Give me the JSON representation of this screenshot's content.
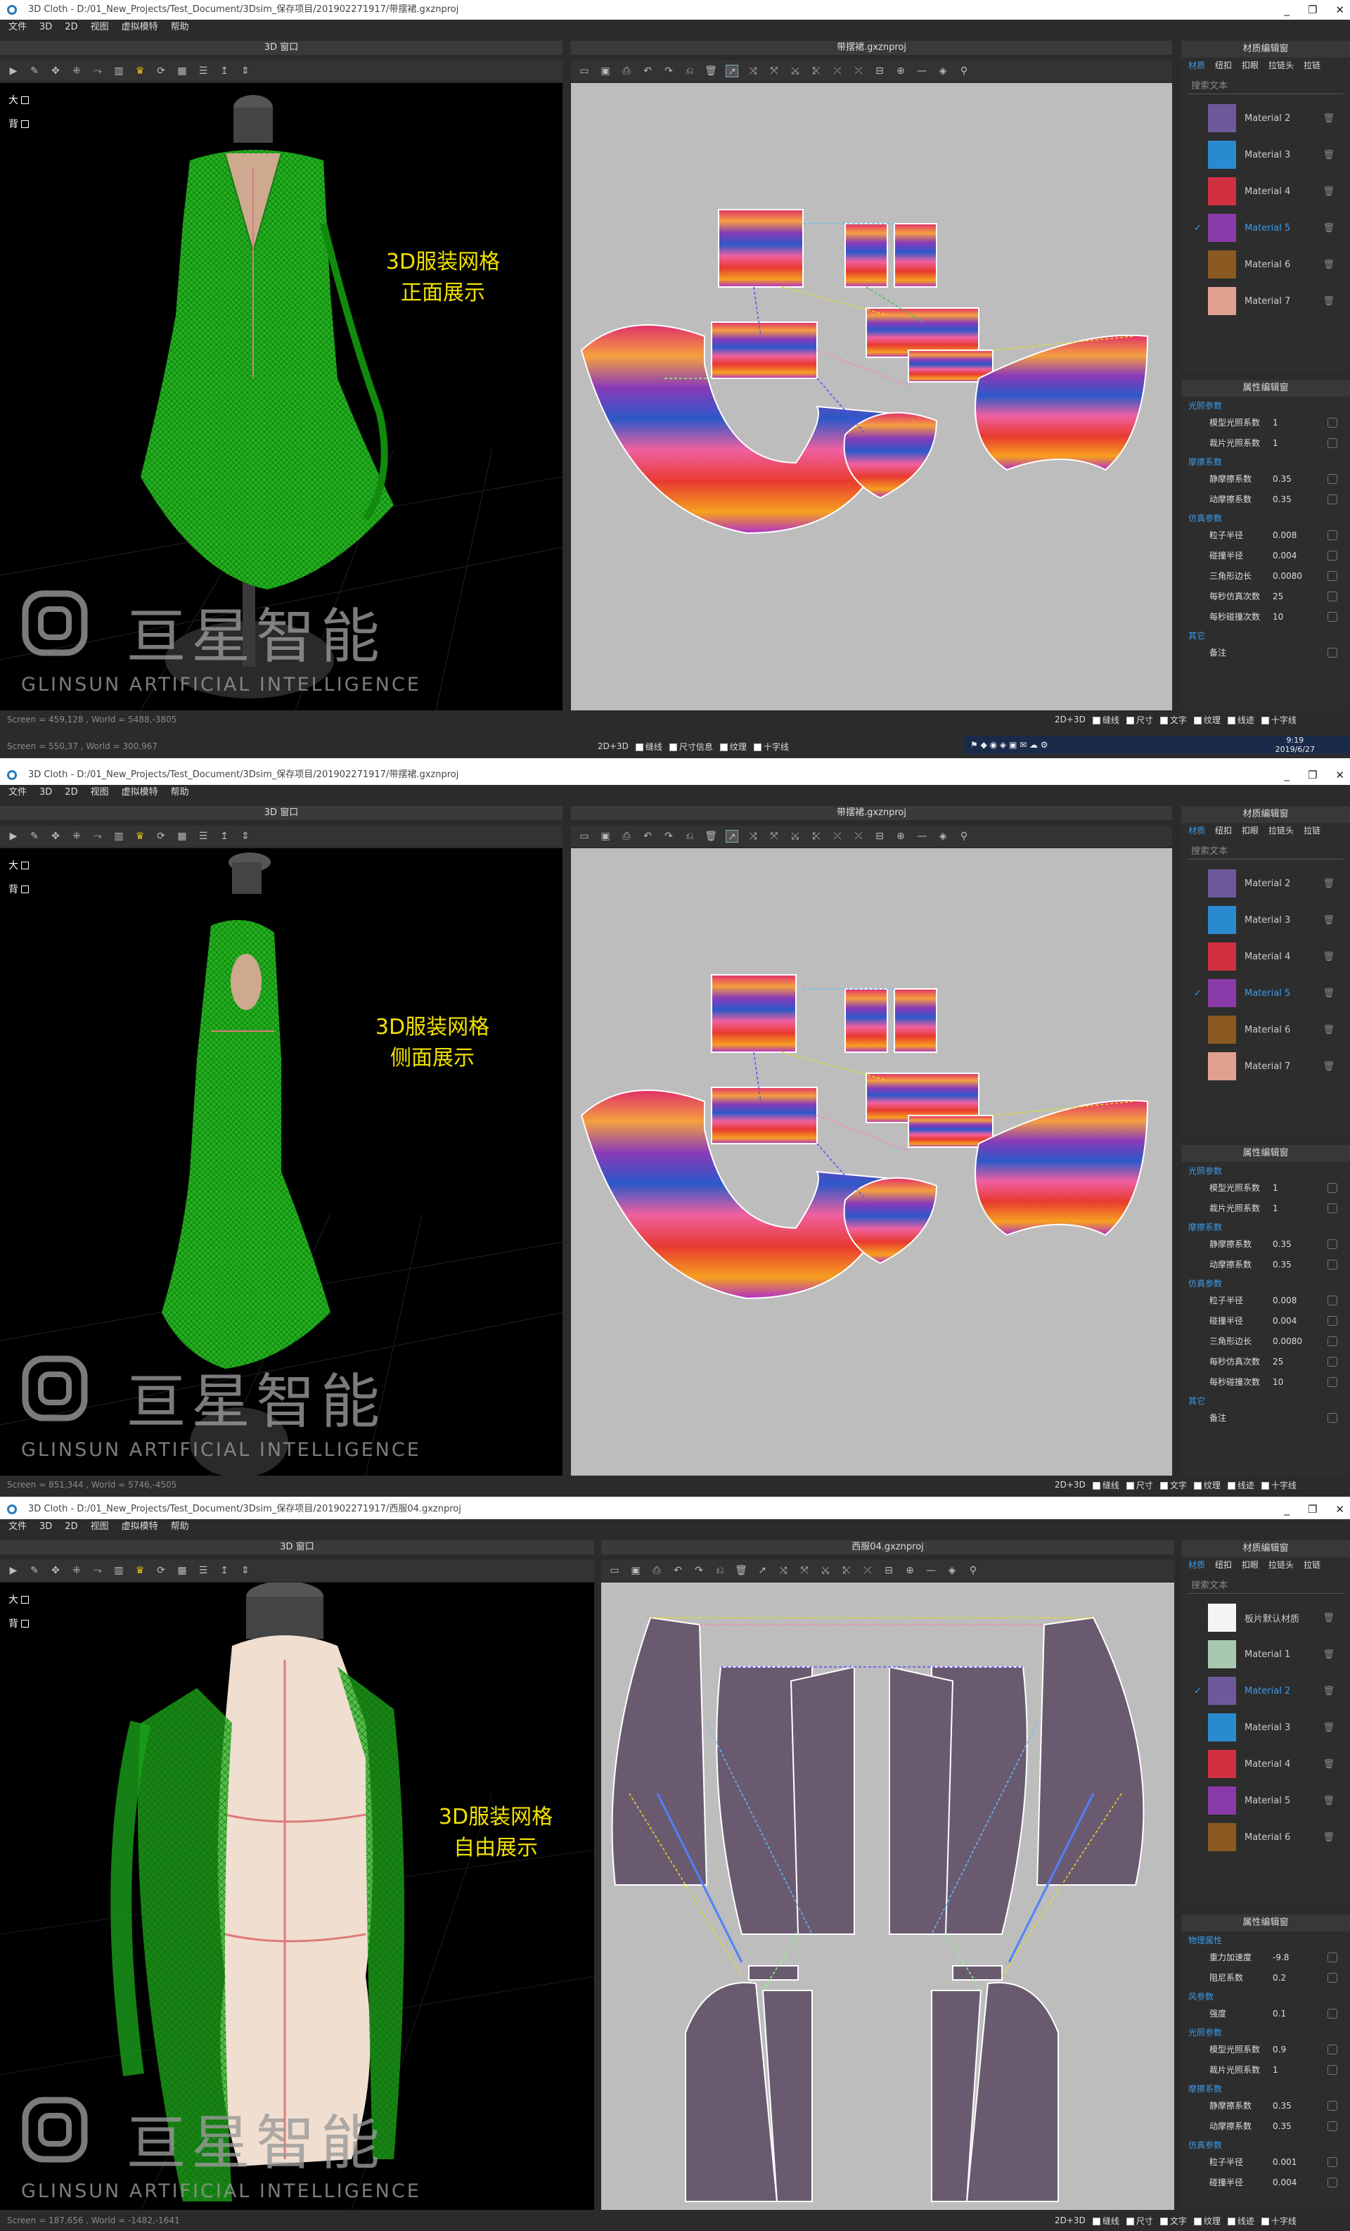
{
  "window_controls": [
    "_",
    "❐",
    "✕"
  ],
  "menu": [
    "文件",
    "3D",
    "2D",
    "视图",
    "虚拟模特",
    "帮助"
  ],
  "panel_3d_title": "3D 窗口",
  "view_toggles": [
    "大",
    "背"
  ],
  "logo": {
    "cn": "亘星智能",
    "en": "GLINSUN ARTIFICIAL INTELLIGENCE"
  },
  "mat_header": "材质编辑窗",
  "prop_header": "属性编辑窗",
  "mat_tabs": [
    "材质",
    "纽扣",
    "扣眼",
    "拉链头",
    "拉链"
  ],
  "search_placeholder": "搜索文本",
  "bottom_options": [
    "2D+3D",
    "缝线",
    "尺寸",
    "文字",
    "纹理",
    "线迹",
    "十字线"
  ],
  "bottom_options_b": [
    "2D+3D",
    "缝线",
    "尺寸信息",
    "纹理",
    "十字线"
  ],
  "colors": {
    "accent": "#3c9ae8",
    "caption": "#f2e000",
    "garment_green": "#22b01e",
    "pattern_bg": "#bdbdbd"
  },
  "shots": [
    {
      "title": "3D Cloth - D:/01_New_Projects/Test_Document/3Dsim_保存项目/201902271917/带摆裙.gxznproj",
      "file_2d": "带摆裙.gxznproj",
      "caption": [
        "3D服装网格",
        "正面展示"
      ],
      "status": "Screen = 459,128 , World = 5488,-3805",
      "status2": "Screen = 550,37 , World = 300,967",
      "materials": [
        {
          "name": "Material 2",
          "sw": "#6e5a9a",
          "sel": false
        },
        {
          "name": "Material 3",
          "sw": "#2a8ad0",
          "sel": false
        },
        {
          "name": "Material 4",
          "sw": "#d03040",
          "sel": false
        },
        {
          "name": "Material 5",
          "sw": "#8a3aa8",
          "sel": true
        },
        {
          "name": "Material 6",
          "sw": "#8a5a20",
          "sel": false
        },
        {
          "name": "Material 7",
          "sw": "#e0a090",
          "sel": false
        }
      ],
      "props": [
        {
          "section": "光照参数",
          "items": [
            [
              "模型光照系数",
              "1"
            ],
            [
              "裁片光照系数",
              "1"
            ]
          ]
        },
        {
          "section": "摩擦系数",
          "items": [
            [
              "静摩擦系数",
              "0.35"
            ],
            [
              "动摩擦系数",
              "0.35"
            ]
          ]
        },
        {
          "section": "仿真参数",
          "items": [
            [
              "粒子半径",
              "0.008"
            ],
            [
              "碰撞半径",
              "0.004"
            ],
            [
              "三角形边长",
              "0.0080"
            ],
            [
              "每秒仿真次数",
              "25"
            ],
            [
              "每秒碰撞次数",
              "10"
            ]
          ]
        },
        {
          "section": "其它",
          "items": [
            [
              "备注",
              ""
            ]
          ]
        }
      ],
      "clock": [
        "9:19",
        "2019/6/27"
      ]
    },
    {
      "title": "3D Cloth - D:/01_New_Projects/Test_Document/3Dsim_保存项目/201902271917/带摆裙.gxznproj",
      "file_2d": "带摆裙.gxznproj",
      "caption": [
        "3D服装网格",
        "侧面展示"
      ],
      "status": "Screen = 851,344 , World = 5746,-4505",
      "materials": [
        {
          "name": "Material 2",
          "sw": "#6e5a9a",
          "sel": false
        },
        {
          "name": "Material 3",
          "sw": "#2a8ad0",
          "sel": false
        },
        {
          "name": "Material 4",
          "sw": "#d03040",
          "sel": false
        },
        {
          "name": "Material 5",
          "sw": "#8a3aa8",
          "sel": true
        },
        {
          "name": "Material 6",
          "sw": "#8a5a20",
          "sel": false
        },
        {
          "name": "Material 7",
          "sw": "#e0a090",
          "sel": false
        }
      ],
      "props": [
        {
          "section": "光照参数",
          "items": [
            [
              "模型光照系数",
              "1"
            ],
            [
              "裁片光照系数",
              "1"
            ]
          ]
        },
        {
          "section": "摩擦系数",
          "items": [
            [
              "静摩擦系数",
              "0.35"
            ],
            [
              "动摩擦系数",
              "0.35"
            ]
          ]
        },
        {
          "section": "仿真参数",
          "items": [
            [
              "粒子半径",
              "0.008"
            ],
            [
              "碰撞半径",
              "0.004"
            ],
            [
              "三角形边长",
              "0.0080"
            ],
            [
              "每秒仿真次数",
              "25"
            ],
            [
              "每秒碰撞次数",
              "10"
            ]
          ]
        },
        {
          "section": "其它",
          "items": [
            [
              "备注",
              ""
            ]
          ]
        }
      ]
    },
    {
      "title": "3D Cloth - D:/01_New_Projects/Test_Document/3Dsim_保存项目/201902271917/西服04.gxznproj",
      "file_2d": "西服04.gxznproj",
      "caption": [
        "3D服装网格",
        "自由展示"
      ],
      "status": "Screen = 187,656 , World = -1482,-1641",
      "materials": [
        {
          "name": "板片默认材质",
          "sw": "#f4f4f4",
          "sel": false
        },
        {
          "name": "Material 1",
          "sw": "#a8c8b0",
          "sel": false
        },
        {
          "name": "Material 2",
          "sw": "#6e5a9a",
          "sel": true
        },
        {
          "name": "Material 3",
          "sw": "#2a8ad0",
          "sel": false
        },
        {
          "name": "Material 4",
          "sw": "#d03040",
          "sel": false
        },
        {
          "name": "Material 5",
          "sw": "#8a3aa8",
          "sel": false
        },
        {
          "name": "Material 6",
          "sw": "#8a5a20",
          "sel": false
        }
      ],
      "props": [
        {
          "section": "物理属性",
          "items": [
            [
              "重力加速度",
              "-9.8"
            ],
            [
              "阻尼系数",
              "0.2"
            ]
          ]
        },
        {
          "section": "风参数",
          "items": [
            [
              "强度",
              "0.1"
            ]
          ]
        },
        {
          "section": "光照参数",
          "items": [
            [
              "模型光照系数",
              "0.9"
            ],
            [
              "裁片光照系数",
              "1"
            ]
          ]
        },
        {
          "section": "摩擦系数",
          "items": [
            [
              "静摩擦系数",
              "0.35"
            ],
            [
              "动摩擦系数",
              "0.35"
            ]
          ]
        },
        {
          "section": "仿真参数",
          "items": [
            [
              "粒子半径",
              "0.001"
            ],
            [
              "碰撞半径",
              "0.004"
            ]
          ]
        }
      ]
    }
  ]
}
